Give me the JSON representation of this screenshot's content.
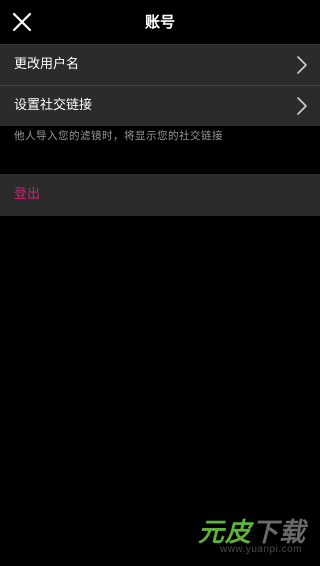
{
  "header": {
    "title": "账号",
    "close_icon": "close-icon"
  },
  "settings": {
    "items": [
      {
        "label": "更改用户名",
        "icon": "chevron-right-icon"
      },
      {
        "label": "设置社交链接",
        "icon": "chevron-right-icon"
      }
    ],
    "hint": "他人导入您的滤镜时，将显示您的社交链接"
  },
  "logout": {
    "label": "登出",
    "color": "#d81b73"
  },
  "watermark": {
    "part1": "元皮",
    "part2": "下载",
    "url": "www.yuanpi.com"
  },
  "colors": {
    "background": "#000000",
    "row_background": "#2b2b2b",
    "accent": "#d81b73",
    "hint_text": "#9a9a9a"
  }
}
